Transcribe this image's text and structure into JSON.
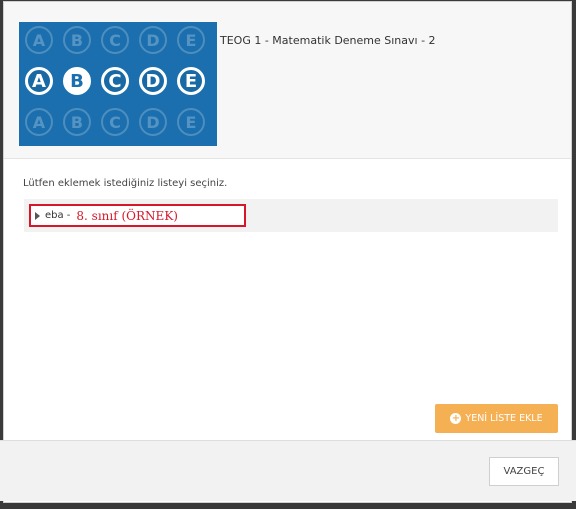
{
  "exam": {
    "title": "TEOG 1 - Matematik Deneme Sınavı - 2",
    "thumbnail": {
      "faded_letters": [
        "A",
        "B",
        "C",
        "D",
        "E"
      ],
      "main_letters": [
        "A",
        "B",
        "C",
        "D",
        "E"
      ],
      "selected_letter": "B",
      "bg_color": "#1b6fae"
    }
  },
  "prompt": "Lütfen eklemek istediğiniz listeyi seçiniz.",
  "list": {
    "items": [
      {
        "prefix": "eba -",
        "name": "8. sınıf (ÖRNEK)"
      }
    ]
  },
  "actions": {
    "add_list_label": "YENİ LİSTE EKLE",
    "cancel_label": "VAZGEÇ",
    "accent_color": "#f6b054",
    "highlight_color": "#d6172a"
  }
}
